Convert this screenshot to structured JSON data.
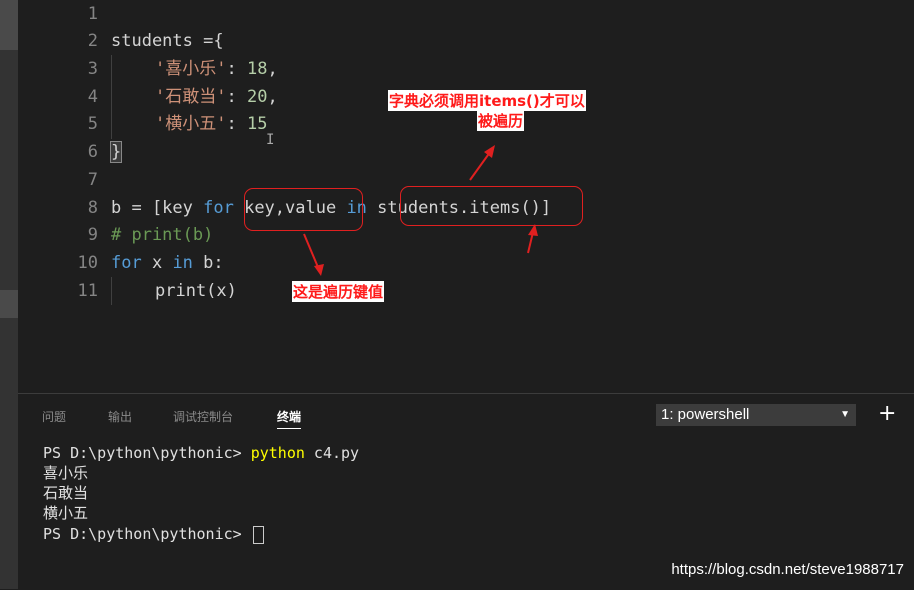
{
  "editor": {
    "line_numbers": [
      "1",
      "2",
      "3",
      "4",
      "5",
      "6",
      "7",
      "8",
      "9",
      "10",
      "11"
    ],
    "code": {
      "l2_var": "students",
      "l2_op": " ={",
      "l3_key": "'喜小乐'",
      "l3_rest": ": ",
      "l3_num": "18",
      "l3_comma": ",",
      "l4_key": "'石敢当'",
      "l4_rest": ": ",
      "l4_num": "20",
      "l4_comma": ",",
      "l5_key": "'横小五'",
      "l5_rest": ": ",
      "l5_num": "15",
      "l6_brace": "}",
      "l8_a": "b = [key ",
      "l8_for": "for",
      "l8_b": " key,value ",
      "l8_in": "in",
      "l8_c": " students.items()]",
      "l9": "# print(b)",
      "l10_for": "for",
      "l10_a": " x ",
      "l10_in": "in",
      "l10_b": " b:",
      "l11": "print(x)"
    }
  },
  "annotations": {
    "items_note_line1": "字典必须调用items()才可以",
    "items_note_line2": "被遍历",
    "keyvalue_note": "这是遍历键值"
  },
  "panel": {
    "tabs": [
      "问题",
      "输出",
      "调试控制台",
      "终端"
    ],
    "active_tab": "终端",
    "terminal_select": "1: powershell",
    "add_icon": "+",
    "terminal": {
      "prompt1": "PS D:\\python\\pythonic> ",
      "cmd": "python",
      "arg": " c4.py",
      "out1": "喜小乐",
      "out2": "石敢当",
      "out3": "横小五",
      "prompt2": "PS D:\\python\\pythonic> "
    }
  },
  "watermark": "https://blog.csdn.net/steve1988717",
  "colors": {
    "background": "#1e1e1e",
    "keyword": "#569cd6",
    "string": "#ce9178",
    "number": "#b5cea8",
    "comment": "#6a9955",
    "annotation": "#ff1a1a",
    "terminal_command": "#ffff00"
  }
}
